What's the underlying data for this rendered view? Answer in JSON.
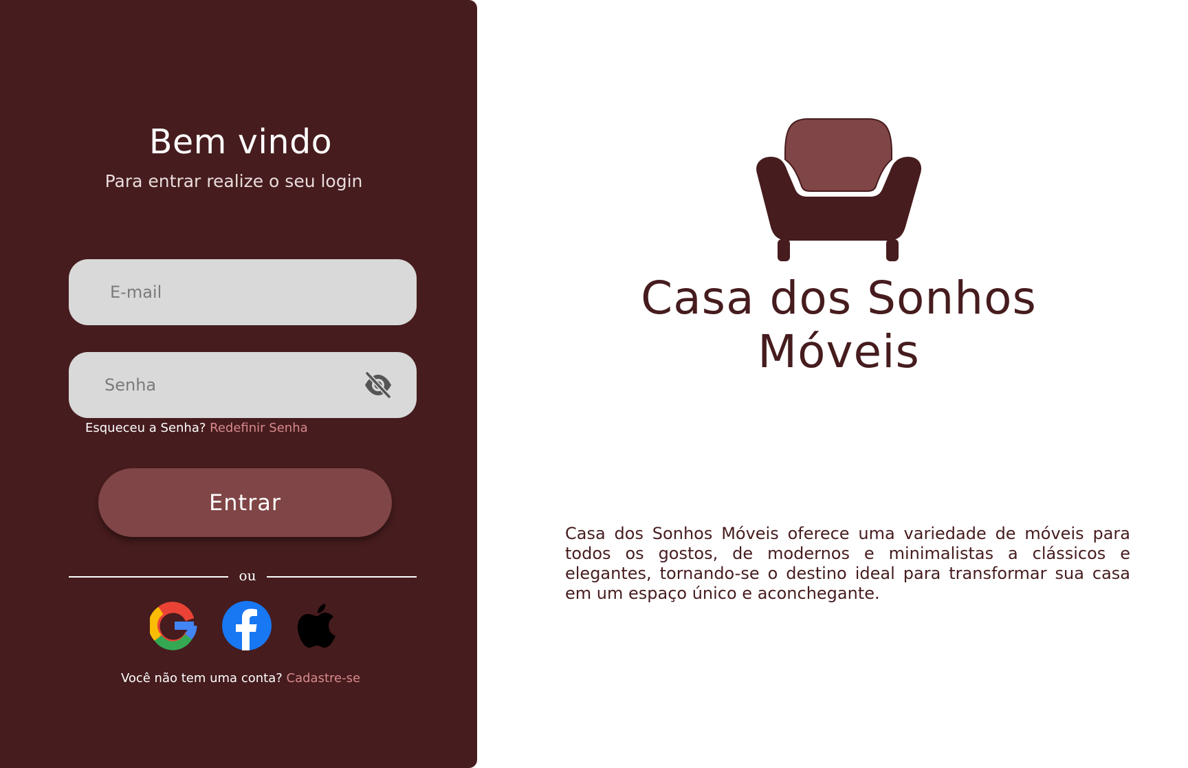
{
  "login": {
    "title": "Bem vindo",
    "subtitle": "Para entrar realize o seu login",
    "email_placeholder": "E-mail",
    "password_placeholder": "Senha",
    "forgot_text": "Esqueceu a Senha?",
    "forgot_link": "Redefinir Senha",
    "submit_label": "Entrar",
    "divider_text": "ou",
    "social_providers": [
      "google-icon",
      "facebook-icon",
      "apple-icon"
    ],
    "signup_text": "Você não tem uma conta?",
    "signup_link": "Cadastre-se"
  },
  "brand": {
    "name_line1": "Casa dos Sonhos",
    "name_line2": "Móveis",
    "logo_icon": "armchair-icon",
    "description": "Casa dos Sonhos Móveis oferece uma variedade de móveis para todos os gostos, de modernos e minimalistas a clássicos e elegantes, tornando-se o destino ideal para transformar sua casa em um espaço único e aconchegante."
  },
  "colors": {
    "panel_bg": "#461c1e",
    "accent": "#804546",
    "link": "#d88a8c",
    "input_bg": "#d9d9d9",
    "brand_text": "#461c1e"
  }
}
